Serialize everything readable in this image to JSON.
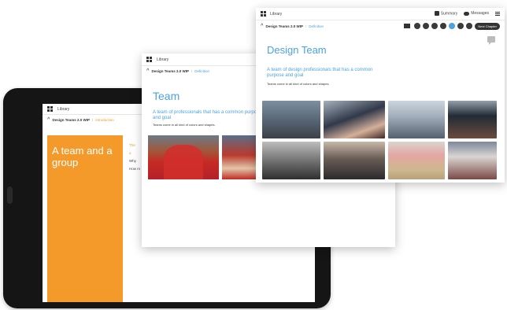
{
  "tablet": {
    "app_label": "Library",
    "breadcrumb": {
      "book": "Design Teams 2.0 WIP",
      "separator": "/",
      "section": "Introduction"
    },
    "chapter_title": "A team and a group",
    "side_text": {
      "line1": "The",
      "line2": "a",
      "line3": "Why",
      "line4": "How m"
    }
  },
  "window_team": {
    "app_label": "Library",
    "breadcrumb": {
      "book": "Design Teams 2.0 WIP",
      "separator": "/",
      "section": "Definition"
    },
    "heading": "Team",
    "subheading": "A team of professionals that has a common purpose and goal",
    "body": "Teams come in all kind of colors and shapes."
  },
  "window_design_team": {
    "app_label": "Library",
    "toolbar": {
      "summary_label": "Summary",
      "messages_label": "Messages"
    },
    "breadcrumb": {
      "book": "Design Teams 2.0 WIP",
      "separator": "/",
      "section": "Definition"
    },
    "next_chapter_label": "Next Chapter",
    "heading": "Design Team",
    "subheading": "A team of design professionals that has a common purpose and goal",
    "body": "Teams come in all kind of colors and shapes."
  },
  "colors": {
    "accent_blue": "#4aa3e0",
    "chapter_orange": "#f39a2b",
    "device_black": "#151515"
  }
}
